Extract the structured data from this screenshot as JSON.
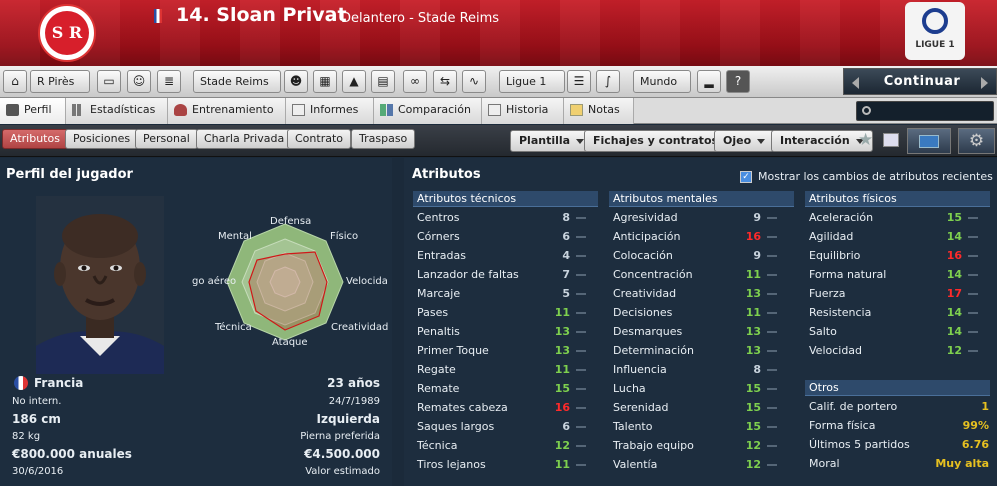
{
  "header": {
    "crest_text": "S R",
    "title": "14. Sloan Privat",
    "subtitle": "Delantero - Stade Reims",
    "league_logo_text": "LIGUE 1"
  },
  "toolbar": {
    "manager": "R Pirès",
    "club": "Stade Reims",
    "league": "Ligue 1",
    "world": "Mundo",
    "help": "?",
    "continue": "Continuar"
  },
  "tabs": [
    "Perfil",
    "Estadísticas",
    "Entrenamiento",
    "Informes",
    "Comparación",
    "Historia",
    "Notas"
  ],
  "search_placeholder": "",
  "subnav": {
    "pills": [
      "Atributos",
      "Posiciones",
      "Personal",
      "Charla Privada",
      "Contrato",
      "Traspaso"
    ],
    "drops": [
      "Plantilla",
      "Fichajes y contratos",
      "Ojeo",
      "Interacción"
    ]
  },
  "profile": {
    "title": "Perfil del jugador",
    "radar_labels": [
      "Defensa",
      "Físico",
      "Velocida",
      "Creatividad",
      "Ataque",
      "Técnica",
      "go aéreo",
      "Mental"
    ],
    "nationality": "Francia",
    "age": "23 años",
    "intl": "No intern.",
    "dob": "24/7/1989",
    "height": "186 cm",
    "foot": "Izquierda",
    "weight": "82 kg",
    "foot_label": "Pierna preferida",
    "wage": "€800.000 anuales",
    "value": "€4.500.000",
    "contract_end": "30/6/2016",
    "value_label": "Valor estimado"
  },
  "attributes": {
    "title": "Atributos",
    "show_changes": "Mostrar los cambios de atributos recientes",
    "technical_title": "Atributos técnicos",
    "technical": [
      {
        "name": "Centros",
        "value": "8",
        "color": "w"
      },
      {
        "name": "Córners",
        "value": "6",
        "color": "w"
      },
      {
        "name": "Entradas",
        "value": "4",
        "color": "w"
      },
      {
        "name": "Lanzador de faltas",
        "value": "7",
        "color": "w"
      },
      {
        "name": "Marcaje",
        "value": "5",
        "color": "w"
      },
      {
        "name": "Pases",
        "value": "11",
        "color": "g"
      },
      {
        "name": "Penaltis",
        "value": "13",
        "color": "g"
      },
      {
        "name": "Primer Toque",
        "value": "13",
        "color": "g"
      },
      {
        "name": "Regate",
        "value": "11",
        "color": "g"
      },
      {
        "name": "Remate",
        "value": "15",
        "color": "g"
      },
      {
        "name": "Remates cabeza",
        "value": "16",
        "color": "r"
      },
      {
        "name": "Saques largos",
        "value": "6",
        "color": "w"
      },
      {
        "name": "Técnica",
        "value": "12",
        "color": "g"
      },
      {
        "name": "Tiros lejanos",
        "value": "11",
        "color": "g"
      }
    ],
    "mental_title": "Atributos mentales",
    "mental": [
      {
        "name": "Agresividad",
        "value": "9",
        "color": "w"
      },
      {
        "name": "Anticipación",
        "value": "16",
        "color": "r"
      },
      {
        "name": "Colocación",
        "value": "9",
        "color": "w"
      },
      {
        "name": "Concentración",
        "value": "11",
        "color": "g"
      },
      {
        "name": "Creatividad",
        "value": "13",
        "color": "g"
      },
      {
        "name": "Decisiones",
        "value": "11",
        "color": "g"
      },
      {
        "name": "Desmarques",
        "value": "13",
        "color": "g"
      },
      {
        "name": "Determinación",
        "value": "13",
        "color": "g"
      },
      {
        "name": "Influencia",
        "value": "8",
        "color": "w"
      },
      {
        "name": "Lucha",
        "value": "15",
        "color": "g"
      },
      {
        "name": "Serenidad",
        "value": "15",
        "color": "g"
      },
      {
        "name": "Talento",
        "value": "15",
        "color": "g"
      },
      {
        "name": "Trabajo equipo",
        "value": "12",
        "color": "g"
      },
      {
        "name": "Valentía",
        "value": "12",
        "color": "g"
      }
    ],
    "physical_title": "Atributos físicos",
    "physical": [
      {
        "name": "Aceleración",
        "value": "15",
        "color": "g"
      },
      {
        "name": "Agilidad",
        "value": "14",
        "color": "g"
      },
      {
        "name": "Equilibrio",
        "value": "16",
        "color": "r"
      },
      {
        "name": "Forma natural",
        "value": "14",
        "color": "g"
      },
      {
        "name": "Fuerza",
        "value": "17",
        "color": "r"
      },
      {
        "name": "Resistencia",
        "value": "14",
        "color": "g"
      },
      {
        "name": "Salto",
        "value": "14",
        "color": "g"
      },
      {
        "name": "Velocidad",
        "value": "12",
        "color": "g"
      }
    ],
    "others_title": "Otros",
    "others": [
      {
        "name": "Calif. de portero",
        "value": "1"
      },
      {
        "name": "Forma física",
        "value": "99%"
      },
      {
        "name": "Últimos 5 partidos",
        "value": "6.76"
      },
      {
        "name": "Moral",
        "value": "Muy alta"
      }
    ]
  },
  "colors": {
    "header_red": "#b5141f",
    "value_white": "#c8d3dd",
    "value_green": "#7ed04e",
    "value_red": "#ff2a2a",
    "value_yellow": "#e6c020"
  }
}
